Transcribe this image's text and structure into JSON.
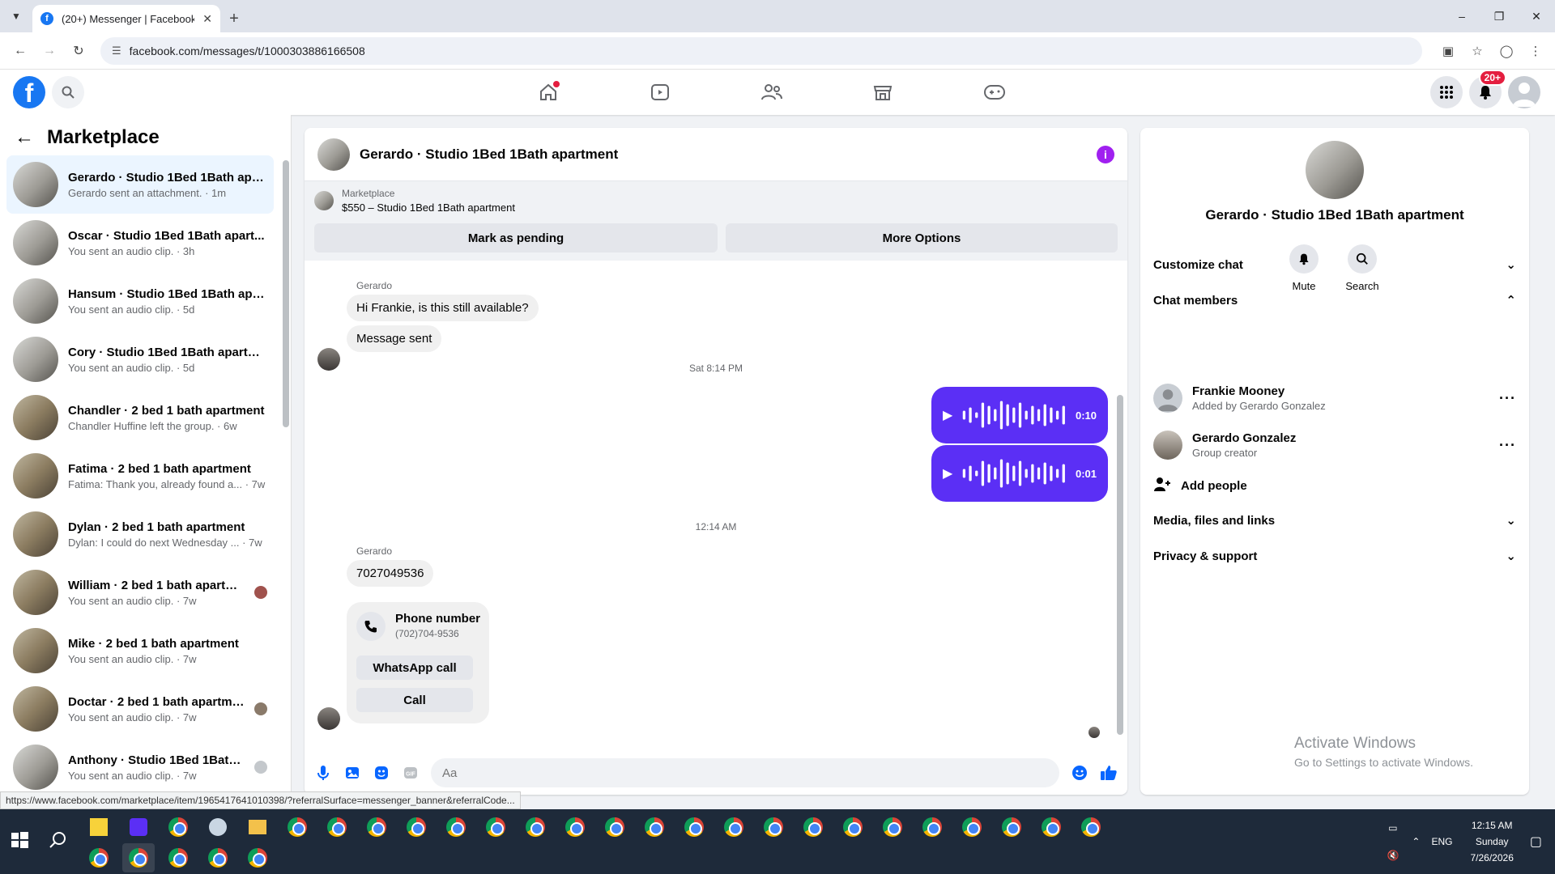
{
  "browser": {
    "tab_title": "(20+) Messenger | Facebook",
    "url": "facebook.com/messages/t/1000303886166508",
    "status_url": "https://www.facebook.com/marketplace/item/1965417641010398/?referralSurface=messenger_banner&referralCode..."
  },
  "header": {
    "notif_badge": "20+"
  },
  "left": {
    "title": "Marketplace",
    "conversations": [
      {
        "name": "Gerardo · Studio 1Bed 1Bath apa...",
        "preview": "Gerardo sent an attachment. · 1m"
      },
      {
        "name": "Oscar · Studio 1Bed 1Bath apart...",
        "preview": "You sent an audio clip. · 3h"
      },
      {
        "name": "Hansum · Studio 1Bed 1Bath apa...",
        "preview": "You sent an audio clip. · 5d"
      },
      {
        "name": "Cory · Studio 1Bed 1Bath apartm...",
        "preview": "You sent an audio clip. · 5d"
      },
      {
        "name": "Chandler · 2 bed 1 bath apartment",
        "preview": "Chandler Huffine left the group. · 6w"
      },
      {
        "name": "Fatima · 2 bed 1 bath apartment",
        "preview": "Fatima: Thank you, already found a... · 7w"
      },
      {
        "name": "Dylan · 2 bed 1 bath apartment",
        "preview": "Dylan: I could do next Wednesday ... · 7w"
      },
      {
        "name": "William · 2 bed 1 bath apartm...",
        "preview": "You sent an audio clip. · 7w"
      },
      {
        "name": "Mike · 2 bed 1 bath apartment",
        "preview": "You sent an audio clip. · 7w"
      },
      {
        "name": "Doctar · 2 bed 1 bath apartment",
        "preview": "You sent an audio clip. · 7w"
      },
      {
        "name": "Anthony · Studio 1Bed 1Bath a...",
        "preview": "You sent an audio clip. · 7w"
      }
    ]
  },
  "chat": {
    "title": "Gerardo · Studio 1Bed 1Bath apartment",
    "banner_label": "Marketplace",
    "banner_price": "$550 – Studio 1Bed 1Bath apartment",
    "btn_pending": "Mark as pending",
    "btn_more": "More Options",
    "sender1": "Gerardo",
    "msg1": "Hi Frankie, is this still available?",
    "msg2": "Message sent",
    "time1": "Sat 8:14 PM",
    "audio1_dur": "0:10",
    "audio2_dur": "0:01",
    "time2": "12:14 AM",
    "sender2": "Gerardo",
    "msg3": "7027049536",
    "card_title": "Phone number",
    "card_number": "(702)704-9536",
    "card_btn1": "WhatsApp call",
    "card_btn2": "Call",
    "composer_placeholder": "Aa"
  },
  "right": {
    "name": "Gerardo · Studio 1Bed 1Bath apartment",
    "mute": "Mute",
    "search": "Search",
    "customize": "Customize chat",
    "members_label": "Chat members",
    "members": [
      {
        "name": "Frankie Mooney",
        "sub": "Added by Gerardo Gonzalez"
      },
      {
        "name": "Gerardo Gonzalez",
        "sub": "Group creator"
      }
    ],
    "add_people": "Add people",
    "media": "Media, files and links",
    "privacy": "Privacy & support",
    "watermark1": "Activate Windows",
    "watermark2": "Go to Settings to activate Windows."
  },
  "taskbar": {
    "lang": "ENG",
    "time": "12:15 AM",
    "day": "Sunday",
    "date": "7/26/2026"
  },
  "colors": {
    "fb_blue": "#1877f2",
    "audio_purple": "#5b2ff5",
    "info_purple": "#a020f0"
  }
}
